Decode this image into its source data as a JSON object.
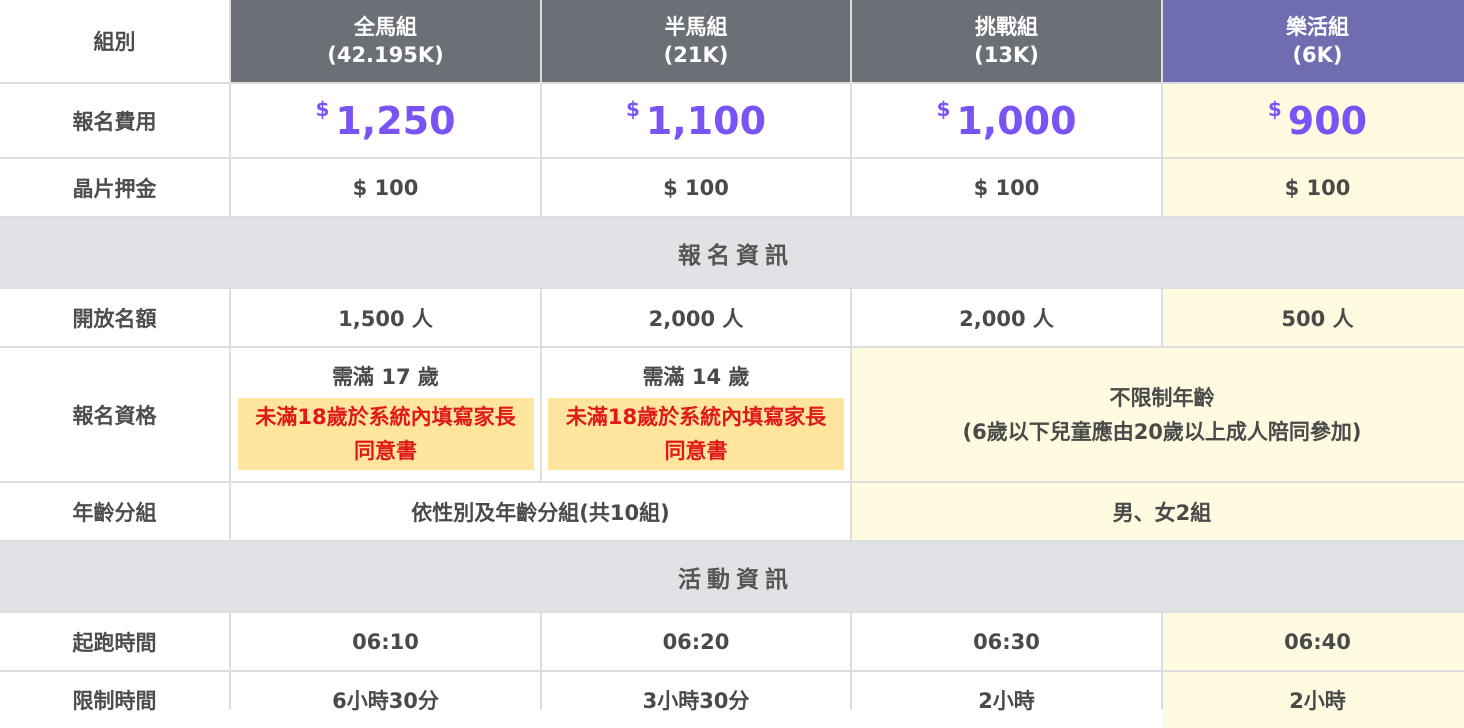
{
  "header": {
    "group_label": "組別",
    "cols": [
      {
        "name": "全馬組",
        "dist": "(42.195K)"
      },
      {
        "name": "半馬組",
        "dist": "(21K)"
      },
      {
        "name": "挑戰組",
        "dist": "(13K)"
      },
      {
        "name": "樂活組",
        "dist": "(6K)"
      }
    ]
  },
  "fee": {
    "label": "報名費用",
    "currency": "$",
    "values": [
      "1,250",
      "1,100",
      "1,000",
      "900"
    ]
  },
  "deposit": {
    "label": "晶片押金",
    "values": [
      "$ 100",
      "$ 100",
      "$ 100",
      "$ 100"
    ]
  },
  "section_registration": "報名資訊",
  "quota": {
    "label": "開放名額",
    "values": [
      "1,500 人",
      "2,000 人",
      "2,000 人",
      "500 人"
    ]
  },
  "eligibility": {
    "label": "報名資格",
    "full": {
      "age": "需滿 17 歲",
      "note_line1": "未滿18歲於系統內填寫家長",
      "note_line2": "同意書"
    },
    "half": {
      "age": "需滿 14 歲",
      "note_line1": "未滿18歲於系統內填寫家長",
      "note_line2": "同意書"
    },
    "other": {
      "line1": "不限制年齡",
      "line2": "(6歲以下兒童應由20歲以上成人陪同參加)"
    }
  },
  "age_group": {
    "label": "年齡分組",
    "competitive": "依性別及年齡分組(共10組)",
    "fun": "男、女2組"
  },
  "section_activity": "活動資訊",
  "start_time": {
    "label": "起跑時間",
    "values": [
      "06:10",
      "06:20",
      "06:30",
      "06:40"
    ]
  },
  "time_limit": {
    "label": "限制時間",
    "values": [
      "6小時30分",
      "3小時30分",
      "2小時",
      "2小時"
    ]
  },
  "colors": {
    "header_gray": "#6b6f76",
    "header_purple": "#706cb0",
    "price_purple": "#7a53f5",
    "fun_bg": "#fffbe0",
    "warn_bg": "#ffe59e",
    "warn_text": "#e01919"
  }
}
